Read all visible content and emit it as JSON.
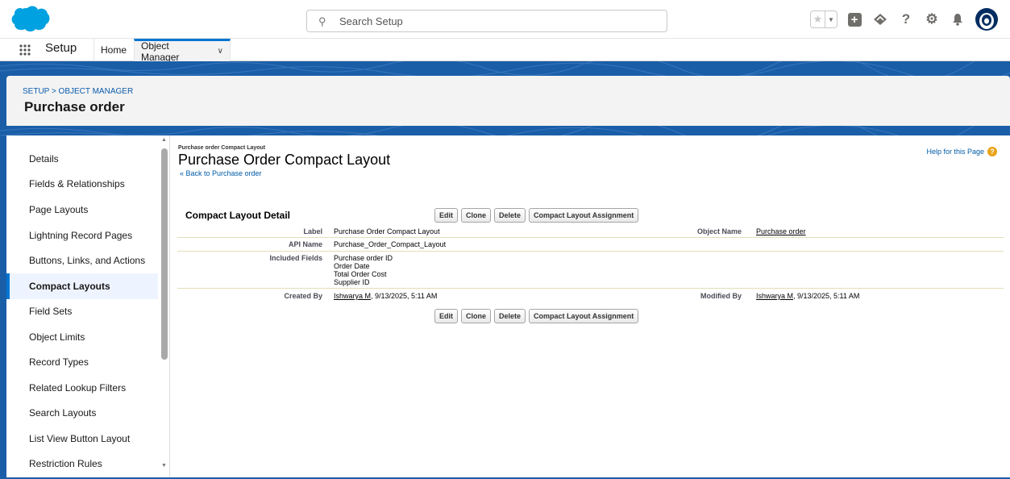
{
  "header": {
    "search_placeholder": "Search Setup",
    "icons": [
      "salesforce-cloud-logo",
      "search-icon",
      "favorites-star-icon",
      "favorites-dropdown-icon",
      "global-actions-plus-icon",
      "trailhead-icon",
      "help-icon",
      "setup-gear-icon",
      "notifications-bell-icon",
      "user-avatar"
    ]
  },
  "nav": {
    "app_name": "Setup",
    "tabs": [
      {
        "label": "Home"
      },
      {
        "label": "Object Manager"
      }
    ]
  },
  "page": {
    "breadcrumb": "SETUP > OBJECT MANAGER",
    "title": "Purchase order"
  },
  "sidebar": {
    "items": [
      {
        "label": "Details"
      },
      {
        "label": "Fields & Relationships"
      },
      {
        "label": "Page Layouts"
      },
      {
        "label": "Lightning Record Pages"
      },
      {
        "label": "Buttons, Links, and Actions"
      },
      {
        "label": "Compact Layouts",
        "active": true
      },
      {
        "label": "Field Sets"
      },
      {
        "label": "Object Limits"
      },
      {
        "label": "Record Types"
      },
      {
        "label": "Related Lookup Filters"
      },
      {
        "label": "Search Layouts"
      },
      {
        "label": "List View Button Layout"
      },
      {
        "label": "Restriction Rules"
      }
    ]
  },
  "detail": {
    "subtitle": "Purchase order Compact Layout",
    "title": "Purchase Order Compact Layout",
    "back_link": "« Back to Purchase order",
    "help_link": "Help for this Page",
    "section_title": "Compact Layout Detail",
    "buttons": {
      "edit": "Edit",
      "clone": "Clone",
      "delete": "Delete",
      "assignment": "Compact Layout Assignment"
    },
    "label_label": "Label",
    "label_value": "Purchase Order Compact Layout",
    "object_name_label": "Object Name",
    "object_name_value": "Purchase order",
    "api_name_label": "API Name",
    "api_name_value": "Purchase_Order_Compact_Layout",
    "included_fields_label": "Included Fields",
    "included_fields": [
      "Purchase order ID",
      "Order Date",
      "Total Order Cost",
      "Supplier ID"
    ],
    "created_by_label": "Created By",
    "created_by_user": "Ishwarya M",
    "created_by_date": ", 9/13/2025, 5:11 AM",
    "modified_by_label": "Modified By",
    "modified_by_user": "Ishwarya M",
    "modified_by_date": ", 9/13/2025, 5:11 AM"
  },
  "colors": {
    "brand_blue": "#0176d3",
    "header_band": "#1a5ea8",
    "link": "#015ba7"
  }
}
